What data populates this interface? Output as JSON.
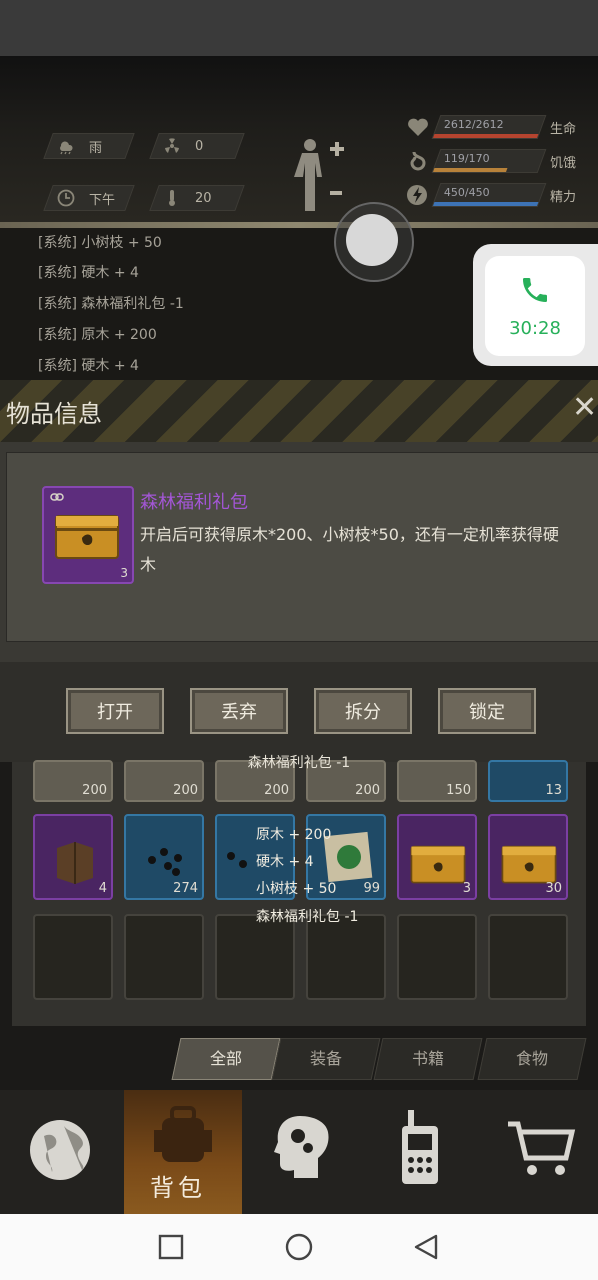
{
  "hud": {
    "weather": "雨",
    "radiation": "0",
    "time_of_day": "下午",
    "temperature": "20",
    "health": {
      "text": "2612/2612",
      "label": "生命",
      "fraction": 1.0,
      "color": "#b5442f"
    },
    "hunger": {
      "text": "119/170",
      "label": "饥饿",
      "fraction": 0.7,
      "color": "#b8823a"
    },
    "energy": {
      "text": "450/450",
      "label": "精力",
      "fraction": 1.0,
      "color": "#3d73b5"
    }
  },
  "log": [
    "[系统] 小树枝 + 50",
    "[系统] 硬木 + 4",
    "[系统] 森林福利礼包 -1",
    "[系统] 原木 + 200",
    "[系统] 硬木 + 4"
  ],
  "call": {
    "time": "30:28"
  },
  "dialog": {
    "title": "物品信息",
    "item_name": "森林福利礼包",
    "item_count": "3",
    "description": "开启后可获得原木*200、小树枝*50，还有一定机率获得硬木",
    "buttons": [
      "打开",
      "丢弃",
      "拆分",
      "锁定"
    ]
  },
  "toast_top": "森林福利礼包 -1",
  "inventory": {
    "row1_qty": [
      "200",
      "200",
      "200",
      "200",
      "150",
      "13"
    ],
    "row2_qty": [
      "4",
      "274",
      "",
      "99",
      "3",
      "30"
    ]
  },
  "floats": [
    "原木 + 200",
    "硬木 + 4",
    "小树枝 + 50",
    "森林福利礼包 -1"
  ],
  "tabs": [
    "全部",
    "装备",
    "书籍",
    "食物"
  ],
  "nav": {
    "bag_label": "背包"
  }
}
